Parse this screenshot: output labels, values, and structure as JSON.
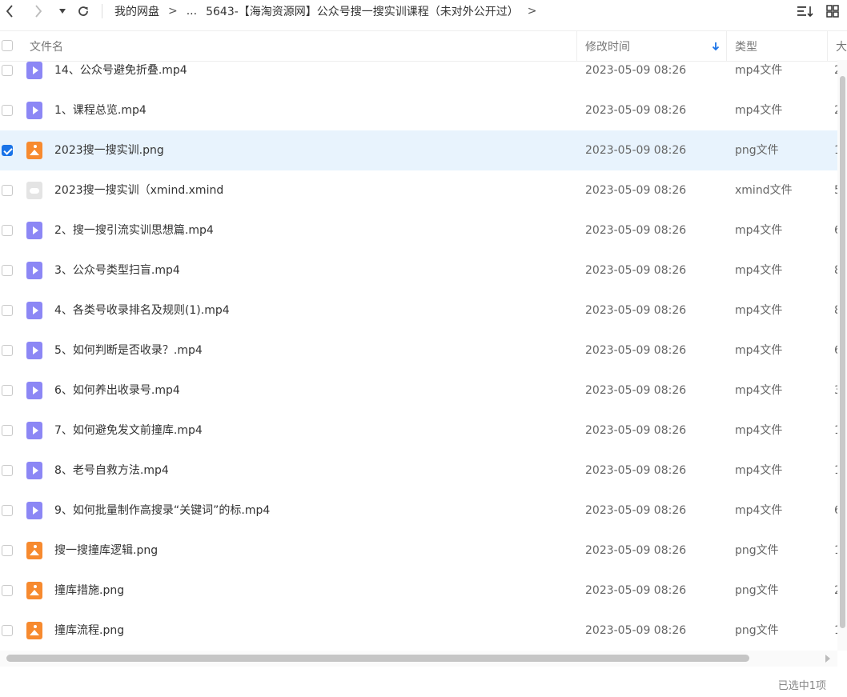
{
  "breadcrumb": {
    "items": [
      "我的网盘",
      "...",
      "5643-【海淘资源网】公众号搜一搜实训课程（未对外公开过）"
    ],
    "separator": ">"
  },
  "header": {
    "name": "文件名",
    "modified": "修改时间",
    "type": "类型",
    "size": "大"
  },
  "rows": [
    {
      "name": "14、公众号避免折叠.mp4",
      "date": "2023-05-09 08:26",
      "type": "mp4文件",
      "size": "2",
      "icon": "mp4",
      "selected": false
    },
    {
      "name": "1、课程总览.mp4",
      "date": "2023-05-09 08:26",
      "type": "mp4文件",
      "size": "2",
      "icon": "mp4",
      "selected": false
    },
    {
      "name": "2023搜一搜实训.png",
      "date": "2023-05-09 08:26",
      "type": "png文件",
      "size": "1",
      "icon": "png",
      "selected": true
    },
    {
      "name": "2023搜一搜实训（xmind.xmind",
      "date": "2023-05-09 08:26",
      "type": "xmind文件",
      "size": "5",
      "icon": "xmind",
      "selected": false
    },
    {
      "name": "2、搜一搜引流实训思想篇.mp4",
      "date": "2023-05-09 08:26",
      "type": "mp4文件",
      "size": "6",
      "icon": "mp4",
      "selected": false
    },
    {
      "name": "3、公众号类型扫盲.mp4",
      "date": "2023-05-09 08:26",
      "type": "mp4文件",
      "size": "8",
      "icon": "mp4",
      "selected": false
    },
    {
      "name": "4、各类号收录排名及规则(1).mp4",
      "date": "2023-05-09 08:26",
      "type": "mp4文件",
      "size": "8",
      "icon": "mp4",
      "selected": false
    },
    {
      "name": "5、如何判断是否收录？.mp4",
      "date": "2023-05-09 08:26",
      "type": "mp4文件",
      "size": "6",
      "icon": "mp4",
      "selected": false
    },
    {
      "name": "6、如何养出收录号.mp4",
      "date": "2023-05-09 08:26",
      "type": "mp4文件",
      "size": "3",
      "icon": "mp4",
      "selected": false
    },
    {
      "name": "7、如何避免发文前撞库.mp4",
      "date": "2023-05-09 08:26",
      "type": "mp4文件",
      "size": "1",
      "icon": "mp4",
      "selected": false
    },
    {
      "name": "8、老号自救方法.mp4",
      "date": "2023-05-09 08:26",
      "type": "mp4文件",
      "size": "1",
      "icon": "mp4",
      "selected": false
    },
    {
      "name": "9、如何批量制作高搜录“关键词”的标.mp4",
      "date": "2023-05-09 08:26",
      "type": "mp4文件",
      "size": "6",
      "icon": "mp4",
      "selected": false
    },
    {
      "name": "搜一搜撞库逻辑.png",
      "date": "2023-05-09 08:26",
      "type": "png文件",
      "size": "1",
      "icon": "png",
      "selected": false
    },
    {
      "name": "撞库措施.png",
      "date": "2023-05-09 08:26",
      "type": "png文件",
      "size": "2",
      "icon": "png",
      "selected": false
    },
    {
      "name": "撞库流程.png",
      "date": "2023-05-09 08:26",
      "type": "png文件",
      "size": "1",
      "icon": "png",
      "selected": false
    }
  ],
  "status": {
    "selected_text": "已选中1项"
  },
  "colors": {
    "accent": "#1a73e8",
    "selected_row": "#e8f3fd",
    "mp4_icon": "#8c87f5",
    "png_icon": "#f78a2f"
  }
}
